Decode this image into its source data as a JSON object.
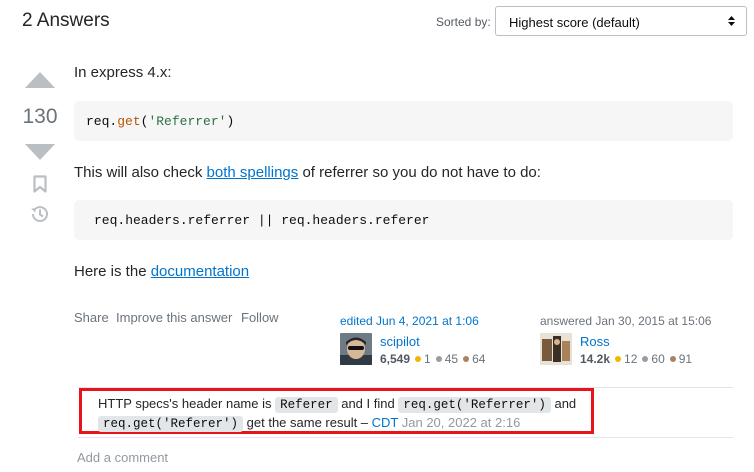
{
  "header": {
    "answers_count": "2 Answers",
    "sorted_label": "Sorted by:",
    "sort_value": "Highest score (default)"
  },
  "votes": {
    "score": "130"
  },
  "answer": {
    "intro": "In express 4.x:",
    "code1": {
      "obj": "req.",
      "method": "get",
      "open": "(",
      "string": "'Referrer'",
      "close": ")"
    },
    "para2_before": "This will also check ",
    "para2_link": "both spellings",
    "para2_after": " of referrer so you do not have to do:",
    "code2": "req.headers.referrer || req.headers.referer",
    "para3_before": "Here is the ",
    "para3_link": "documentation"
  },
  "post_menu": {
    "share": "Share",
    "improve": "Improve this answer",
    "follow": "Follow"
  },
  "editor": {
    "action": "edited Jun 4, 2021 at 1:06",
    "name": "scipilot",
    "reputation": "6,549",
    "gold": "1",
    "silver": "45",
    "bronze": "64"
  },
  "author": {
    "action": "answered Jan 30, 2015 at 15:06",
    "name": "Ross",
    "reputation": "14.2k",
    "gold": "12",
    "silver": "60",
    "bronze": "91"
  },
  "comment": {
    "text1": "HTTP specs's header name is ",
    "code1": "Referer",
    "text2": " and I find ",
    "code2": "req.get('Referrer')",
    "text3": " and",
    "code3": "req.get('Referer')",
    "text4": " get the same result – ",
    "user": "CDT",
    "date": " Jan 20, 2022 at 2:16"
  },
  "add_comment": "Add a comment",
  "colors": {
    "link": "#0074cc",
    "gold": "#f1b600",
    "silver": "#9a9c9f",
    "bronze": "#ab825f",
    "highlight_border": "#e8141b"
  }
}
